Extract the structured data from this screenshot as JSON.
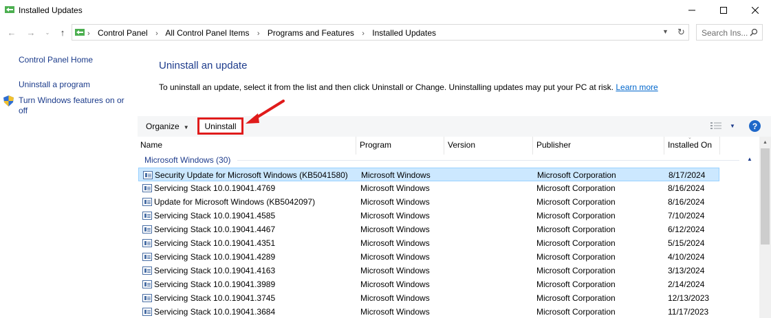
{
  "window": {
    "title": "Installed Updates",
    "icon": "programs-features-icon"
  },
  "address_bar": {
    "crumbs": [
      "Control Panel",
      "All Control Panel Items",
      "Programs and Features",
      "Installed Updates"
    ],
    "search_placeholder": "Search Ins..."
  },
  "sidebar": {
    "home": "Control Panel Home",
    "uninstall_program": "Uninstall a program",
    "windows_features_line1": "Turn Windows features on or",
    "windows_features_line2": "off"
  },
  "main": {
    "heading": "Uninstall an update",
    "description": "To uninstall an update, select it from the list and then click Uninstall or Change. Uninstalling updates may put your PC at risk.",
    "learn_more": "Learn more"
  },
  "toolbar": {
    "organize": "Organize",
    "uninstall": "Uninstall",
    "help": "?"
  },
  "table": {
    "columns": [
      "Name",
      "Program",
      "Version",
      "Publisher",
      "Installed On"
    ],
    "group": "Microsoft Windows (30)",
    "rows": [
      {
        "name": "Security Update for Microsoft Windows (KB5041580)",
        "program": "Microsoft Windows",
        "version": "",
        "publisher": "Microsoft Corporation",
        "installed": "8/17/2024"
      },
      {
        "name": "Servicing Stack 10.0.19041.4769",
        "program": "Microsoft Windows",
        "version": "",
        "publisher": "Microsoft Corporation",
        "installed": "8/16/2024"
      },
      {
        "name": "Update for Microsoft Windows (KB5042097)",
        "program": "Microsoft Windows",
        "version": "",
        "publisher": "Microsoft Corporation",
        "installed": "8/16/2024"
      },
      {
        "name": "Servicing Stack 10.0.19041.4585",
        "program": "Microsoft Windows",
        "version": "",
        "publisher": "Microsoft Corporation",
        "installed": "7/10/2024"
      },
      {
        "name": "Servicing Stack 10.0.19041.4467",
        "program": "Microsoft Windows",
        "version": "",
        "publisher": "Microsoft Corporation",
        "installed": "6/12/2024"
      },
      {
        "name": "Servicing Stack 10.0.19041.4351",
        "program": "Microsoft Windows",
        "version": "",
        "publisher": "Microsoft Corporation",
        "installed": "5/15/2024"
      },
      {
        "name": "Servicing Stack 10.0.19041.4289",
        "program": "Microsoft Windows",
        "version": "",
        "publisher": "Microsoft Corporation",
        "installed": "4/10/2024"
      },
      {
        "name": "Servicing Stack 10.0.19041.4163",
        "program": "Microsoft Windows",
        "version": "",
        "publisher": "Microsoft Corporation",
        "installed": "3/13/2024"
      },
      {
        "name": "Servicing Stack 10.0.19041.3989",
        "program": "Microsoft Windows",
        "version": "",
        "publisher": "Microsoft Corporation",
        "installed": "2/14/2024"
      },
      {
        "name": "Servicing Stack 10.0.19041.3745",
        "program": "Microsoft Windows",
        "version": "",
        "publisher": "Microsoft Corporation",
        "installed": "12/13/2023"
      },
      {
        "name": "Servicing Stack 10.0.19041.3684",
        "program": "Microsoft Windows",
        "version": "",
        "publisher": "Microsoft Corporation",
        "installed": "11/17/2023"
      }
    ]
  },
  "colors": {
    "link": "#1a3a8a",
    "heading": "#1e3c8c",
    "selection": "#cce8ff",
    "annotation": "#e01b1b"
  }
}
